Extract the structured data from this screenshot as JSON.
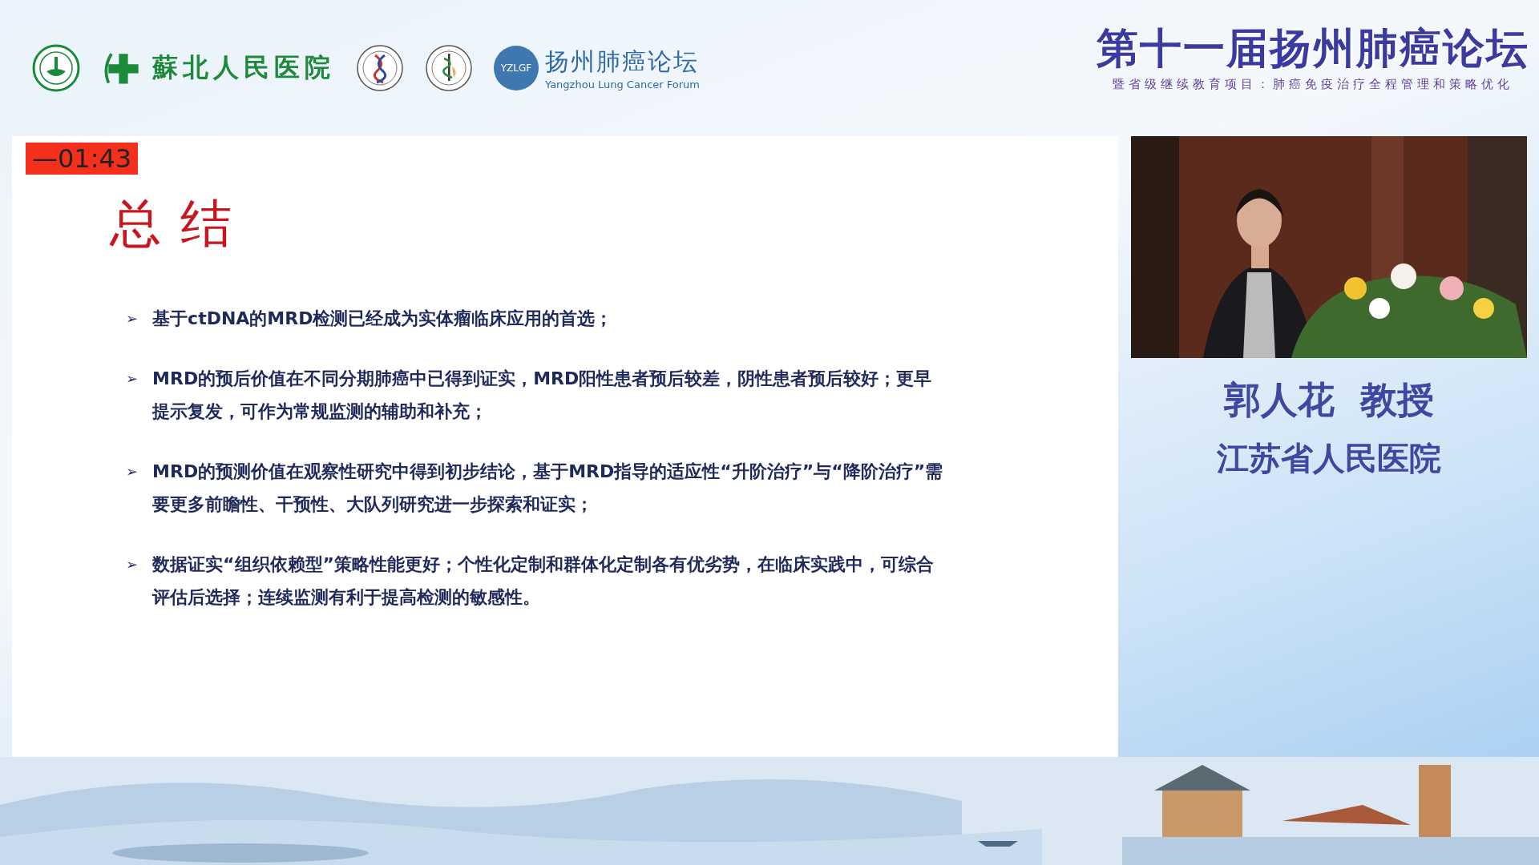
{
  "header": {
    "hospital_logo": {
      "name": "蘇北人民医院"
    },
    "forum_logo": {
      "badge": "YZLGF",
      "name": "扬州肺癌论坛",
      "name_en": "Yangzhou Lung Cancer Forum"
    },
    "event_banner": {
      "title": "第十一届扬州肺癌论坛",
      "subtitle": "暨省级继续教育项目：肺癌免疫治疗全程管理和策略优化"
    }
  },
  "slide": {
    "timer": "—01:43",
    "title": "总结",
    "bullets": [
      {
        "marker": "➢",
        "text": "基于ctDNA的MRD检测已经成为实体瘤临床应用的首选；"
      },
      {
        "marker": "➢",
        "text": "MRD的预后价值在不同分期肺癌中已得到证实，MRD阳性患者预后较差，阴性患者预后较好；更早提示复发，可作为常规监测的辅助和补充；"
      },
      {
        "marker": "➢",
        "text": "MRD的预测价值在观察性研究中得到初步结论，基于MRD指导的适应性“升阶治疗”与“降阶治疗”需要更多前瞻性、干预性、大队列研究进一步探索和证实；"
      },
      {
        "marker": "➢",
        "text": "数据证实“组织依赖型”策略性能更好；个性化定制和群体化定制各有优劣势，在临床实践中，可综合评估后选择；连续监测有利于提高检测的敏感性。"
      }
    ]
  },
  "speaker": {
    "name": "郭人花  教授",
    "affiliation": "江苏省人民医院"
  }
}
